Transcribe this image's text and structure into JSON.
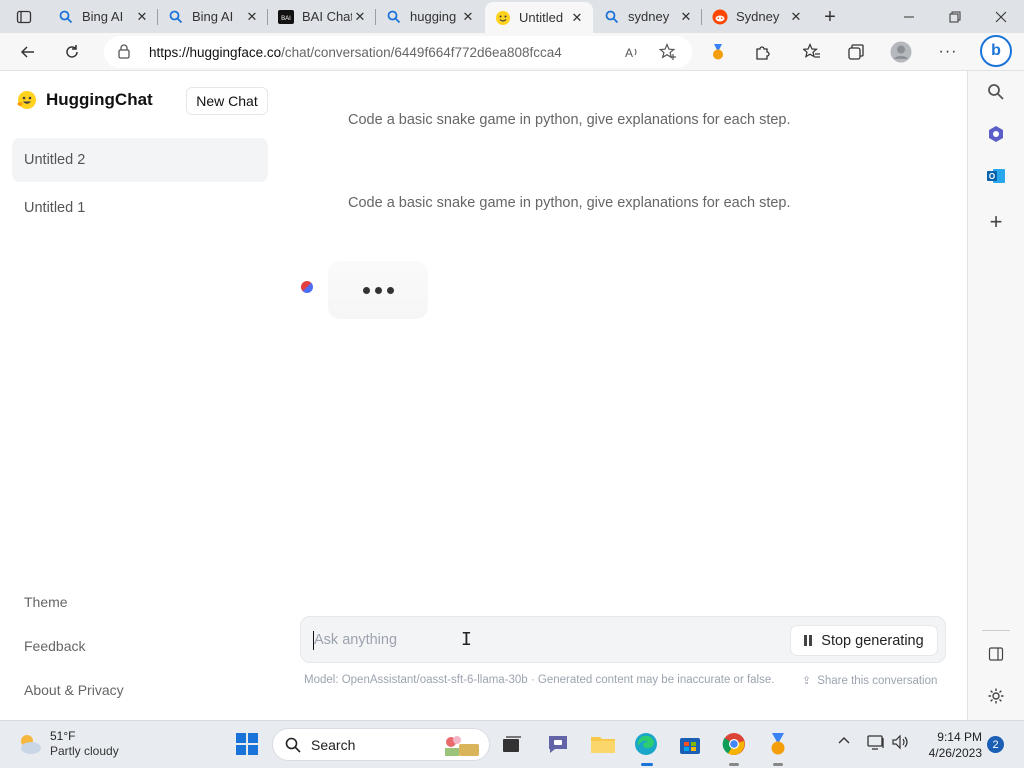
{
  "browser": {
    "tabs": [
      {
        "title": "Bing AI",
        "icon": "search-icon",
        "active": false
      },
      {
        "title": "Bing AI",
        "icon": "search-icon",
        "active": false
      },
      {
        "title": "BAI Chat",
        "icon": "bai-chat-icon",
        "active": false
      },
      {
        "title": "hugging",
        "icon": "search-icon",
        "active": false
      },
      {
        "title": "Untitled",
        "icon": "hugging-face-icon",
        "active": true
      },
      {
        "title": "sydney",
        "icon": "search-icon",
        "active": false
      },
      {
        "title": "Sydney",
        "icon": "reddit-icon",
        "active": false
      }
    ],
    "url_host": "https://huggingface.co",
    "url_path": "/chat/conversation/6449f664f772d6ea808fcca4"
  },
  "sidebar": {
    "brand": "HuggingChat",
    "new_chat_label": "New Chat",
    "conversations": [
      "Untitled 2",
      "Untitled 1"
    ],
    "links": [
      "Theme",
      "Feedback",
      "About & Privacy"
    ]
  },
  "chat": {
    "messages": [
      "Code a basic snake game in python, give explanations for each step.",
      "Code a basic snake game in python, give explanations for each step."
    ],
    "input_placeholder": "Ask anything",
    "stop_label": "Stop generating",
    "footnote": "Model: OpenAssistant/oasst-sft-6-llama-30b · Generated content may be inaccurate or false.",
    "share_label": "Share this conversation"
  },
  "taskbar": {
    "weather_temp": "51°F",
    "weather_desc": "Partly cloudy",
    "search_label": "Search",
    "time": "9:14 PM",
    "date": "4/26/2023",
    "notifications": "2"
  },
  "colors": {
    "accent": "#1a73d9",
    "brand_yellow": "#FFD21E"
  }
}
